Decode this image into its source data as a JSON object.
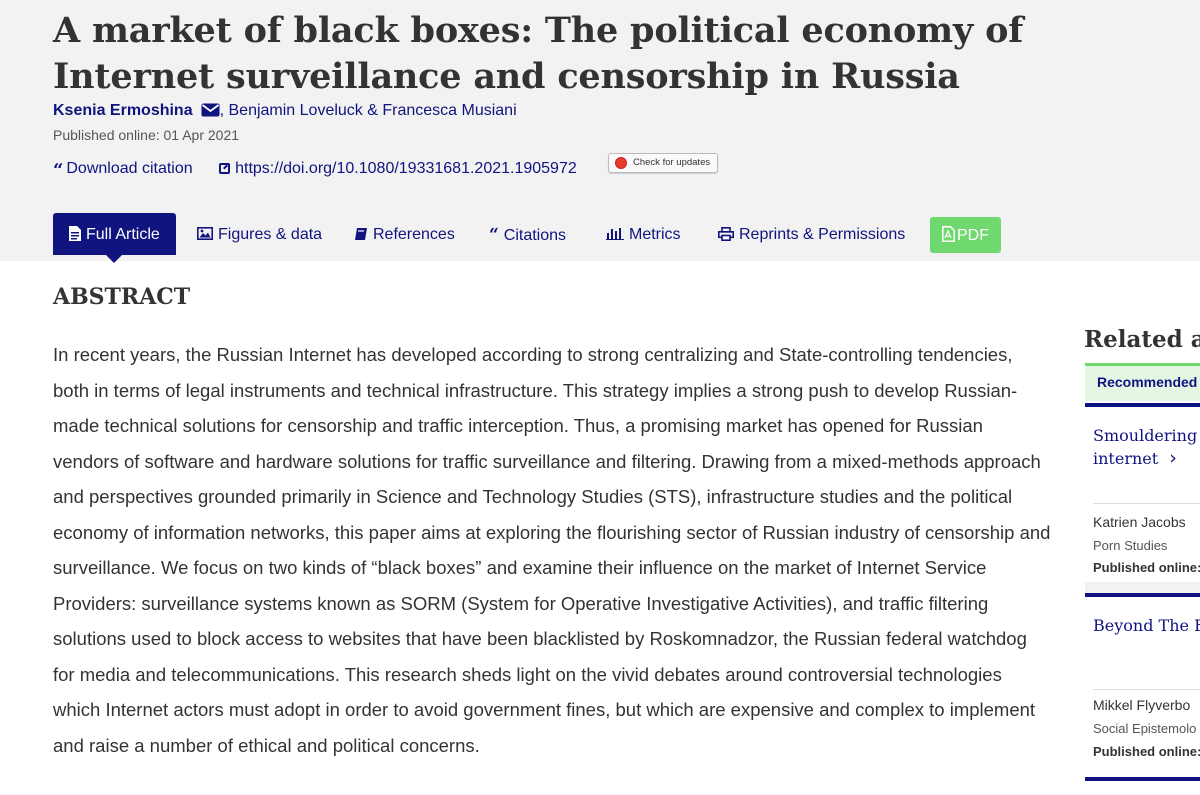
{
  "article": {
    "title": "A market of black boxes: The political economy of Internet surveillance and censorship in Russia",
    "author1": "Ksenia Ermoshina",
    "authors_rest": ", Benjamin Loveluck & Francesca Musiani",
    "published": "Published online: 01 Apr 2021",
    "download_citation": "Download citation",
    "doi": "https://doi.org/10.1080/19331681.2021.1905972",
    "check_updates": "Check for updates"
  },
  "tabs": [
    {
      "label": "Full Article",
      "icon": "document-icon"
    },
    {
      "label": "Figures & data",
      "icon": "image-icon"
    },
    {
      "label": "References",
      "icon": "book-icon"
    },
    {
      "label": "Citations",
      "icon": "quote-icon"
    },
    {
      "label": "Metrics",
      "icon": "bar-chart-icon"
    },
    {
      "label": "Reprints & Permissions",
      "icon": "print-icon"
    },
    {
      "label": "PDF",
      "icon": "pdf-icon"
    }
  ],
  "abstract": {
    "heading": "ABSTRACT",
    "text": "In recent years, the Russian Internet has developed according to strong centralizing and State-controlling tendencies, both in terms of legal instruments and technical infrastructure. This strategy implies a strong push to develop Russian-made technical solutions for censorship and traffic interception. Thus, a promising market has opened for Russian vendors of software and hardware solutions for traffic surveillance and filtering. Drawing from a mixed-methods approach and perspectives grounded primarily in Science and Technology Studies (STS), infrastructure studies and the political economy of information networks, this paper aims at exploring the flourishing sector of Russian industry of censorship and surveillance. We focus on two kinds of “black boxes” and examine their influence on the market of Internet Service Providers: surveillance systems known as SORM (System for Operative Investigative Activities), and traffic filtering solutions used to block access to websites that have been blacklisted by Roskomnadzor, the Russian federal watchdog for media and telecommunications. This research sheds light on the vivid debates around controversial technologies which Internet actors must adopt in order to avoid government fines, but which are expensive and complex to implement and raise a number of ethical and political concerns."
  },
  "sidebar": {
    "heading": "Related art",
    "tab": "Recommended",
    "cards": [
      {
        "title": "Smouldering p internet",
        "arrow": "›",
        "author": "Katrien Jacobs",
        "journal": "Porn Studies",
        "published": "Published online:"
      },
      {
        "title": "Beyond The Bl",
        "author": "Mikkel Flyverbo",
        "journal": "Social Epistemolo",
        "published": "Published online:"
      }
    ]
  },
  "colors": {
    "brand_navy": "#10147e",
    "pdf_green": "#6fd96f",
    "header_bg": "#f2f2f2"
  }
}
